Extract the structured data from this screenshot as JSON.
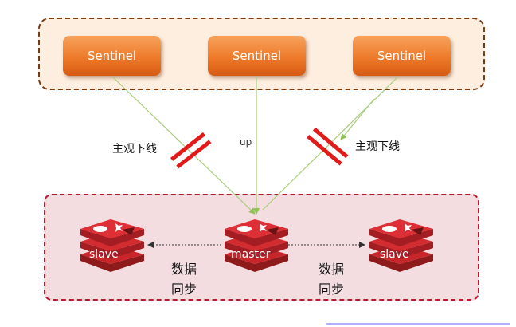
{
  "sentinels": [
    {
      "label": "Sentinel"
    },
    {
      "label": "Sentinel"
    },
    {
      "label": "Sentinel"
    }
  ],
  "links": {
    "left_label": "主观下线",
    "middle_label": "up",
    "right_label": "主观下线"
  },
  "nodes": {
    "left": {
      "label": "slave"
    },
    "center": {
      "label": "master"
    },
    "right": {
      "label": "slave"
    }
  },
  "sync": {
    "left": {
      "line1": "数据",
      "line2": "同步"
    },
    "right": {
      "line1": "数据",
      "line2": "同步"
    }
  },
  "colors": {
    "sentinel_box": "#ee7a2a",
    "redis_red": "#c9262c",
    "link_line": "#9bc46a",
    "cut_mark": "#e11a1a",
    "top_border": "#7a3b12",
    "bottom_border": "#b81b2f"
  }
}
